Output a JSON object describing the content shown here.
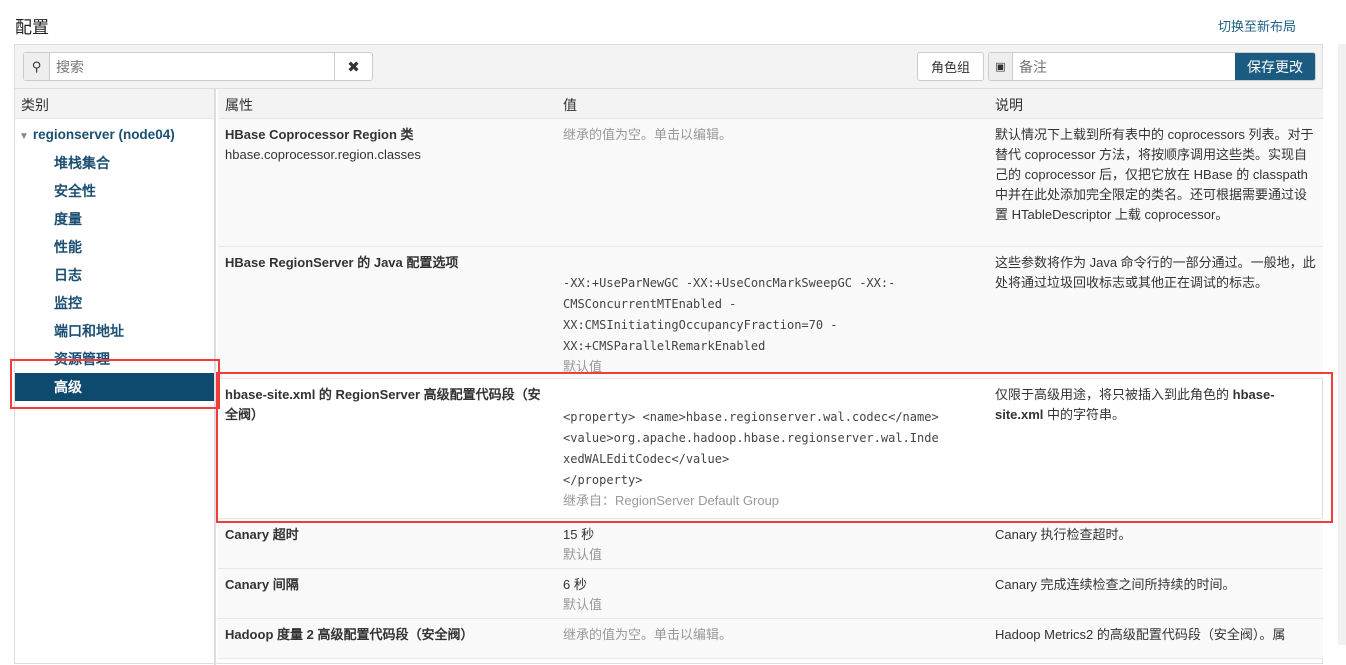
{
  "header": {
    "title": "配置",
    "switch_layout": "切换至新布局"
  },
  "toolbar": {
    "search_placeholder": "搜索",
    "role_group": "角色组",
    "note_placeholder": "备注",
    "save": "保存更改"
  },
  "sidebar": {
    "header": "类别",
    "root": "regionserver (node04)",
    "items": [
      "堆栈集合",
      "安全性",
      "度量",
      "性能",
      "日志",
      "监控",
      "端口和地址",
      "资源管理",
      "高级"
    ],
    "selected": "高级"
  },
  "table": {
    "headers": [
      "属性",
      "值",
      "说明"
    ],
    "rows": [
      {
        "name": "HBase Coprocessor Region 类",
        "key": "hbase.coprocessor.region.classes",
        "value_lines": [],
        "value_note": "继承的值为空。单击以编辑。",
        "note_top": true,
        "desc": "默认情况下上载到所有表中的 coprocessors 列表。对于替代 coprocessor 方法，将按顺序调用这些类。实现自己的 coprocessor 后，仅把它放在 HBase 的 classpath 中并在此处添加完全限定的类名。还可根据需要通过设置 HTableDescriptor 上载 coprocessor。"
      },
      {
        "name": "HBase RegionServer 的 Java 配置选项",
        "key": "",
        "value_lines": [
          "-XX:+UseParNewGC -XX:+UseConcMarkSweepGC -XX:-",
          "CMSConcurrentMTEnabled -",
          "XX:CMSInitiatingOccupancyFraction=70 -",
          "XX:+CMSParallelRemarkEnabled"
        ],
        "value_note": "默认值",
        "desc": "这些参数将作为 Java 命令行的一部分通过。一般地，此处将通过垃圾回收标志或其他正在调试的标志。"
      },
      {
        "name": "hbase-site.xml 的 RegionServer 高级配置代码段（安全阀）",
        "key": "",
        "value_lines": [
          "<property> <name>hbase.regionserver.wal.codec</name>",
          "<value>org.apache.hadoop.hbase.regionserver.wal.Inde",
          "xedWALEditCodec</value>",
          "</property>"
        ],
        "value_note": "继承自：RegionServer Default Group",
        "desc_pre": "仅限于高级用途，将只被插入到此角色的 ",
        "desc_bold": "hbase-site.xml",
        "desc_post": " 中的字符串。"
      },
      {
        "name": "Canary 超时",
        "value_text": "15 秒",
        "value_note": "默认值",
        "desc": "Canary 执行检查超时。"
      },
      {
        "name": "Canary 间隔",
        "value_text": "6 秒",
        "value_note": "默认值",
        "desc": "Canary 完成连续检查之间所持续的时间。"
      },
      {
        "name": "Hadoop 度量 2 高级配置代码段（安全阀）",
        "value_note": "继承的值为空。单击以编辑。",
        "desc": "Hadoop Metrics2 的高级配置代码段（安全阀）。属"
      }
    ]
  },
  "colors": {
    "accent": "#1b5b82",
    "selected": "#0e4a6e",
    "annotation": "#f03c3c"
  }
}
